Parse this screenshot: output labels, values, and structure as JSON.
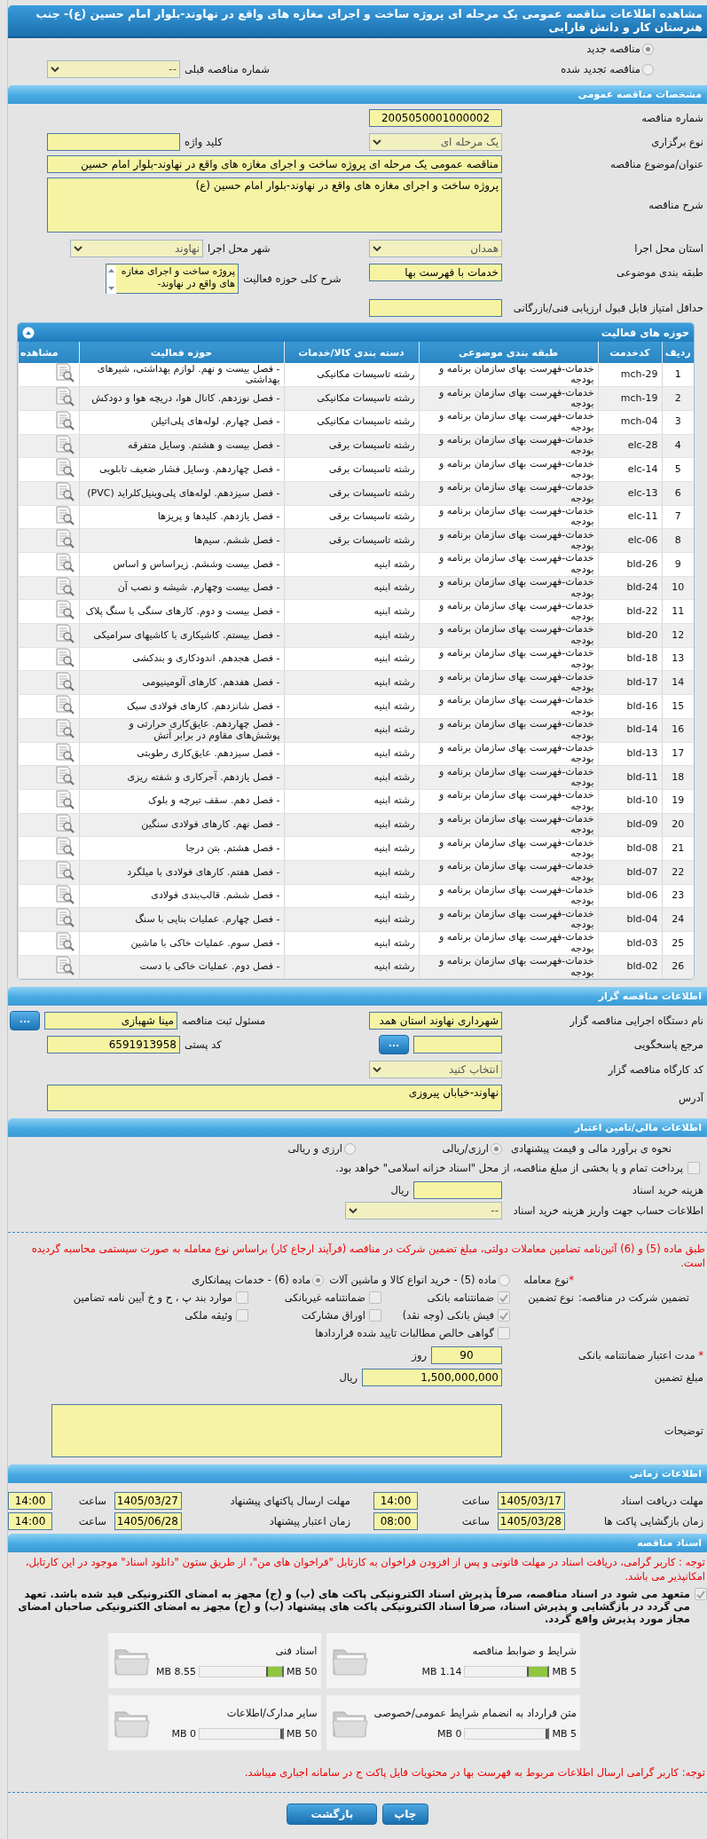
{
  "title": "مشاهده اطلاعات مناقصه عمومی یک مرحله ای پروژه ساخت و اجرای مغازه های واقع در نهاوند-بلوار امام حسین (ع)- جنب هنرستان کار و دانش فارابی",
  "tender_kind": [
    {
      "label": "مناقصه جدید",
      "selected": true
    },
    {
      "label": "مناقصه تجدید شده",
      "selected": false
    }
  ],
  "previous_number": {
    "label": "شماره مناقصه قبلی",
    "value": "--"
  },
  "general": {
    "header": "مشخصات مناقصه عمومی",
    "rows": [
      [
        {
          "label": "شماره مناقصه",
          "kind": "text",
          "value": "2005050001000002"
        }
      ],
      [
        {
          "label": "نوع برگزاری",
          "kind": "select",
          "value": "یک مرحله ای"
        },
        {
          "label": "کلید واژه",
          "kind": "text"
        }
      ],
      [
        {
          "label": "عنوان/موضوع مناقصه",
          "kind": "wide",
          "value": "مناقصه عمومی یک مرحله ای پروژه ساخت و اجرای مغازه های واقع در نهاوند-بلوار امام حسین"
        }
      ],
      [
        {
          "label": "شرح مناقصه",
          "kind": "textarea",
          "value": "پروژه ساخت و اجرای  مغازه های واقع در نهاوند-بلوار امام حسین (ع)"
        }
      ],
      [
        {
          "label": "استان محل اجرا",
          "kind": "select",
          "value": "همدان"
        },
        {
          "label": "شهر محل اجرا",
          "kind": "select",
          "value": "نهاوند"
        }
      ],
      [
        {
          "label": "طبقه بندی موضوعی",
          "kind": "text",
          "value": "خدمات با فهرست بها"
        },
        {
          "label": "شرح کلی حوزه فعالیت",
          "kind": "list",
          "value": "پروژه ساخت و اجرای مغازه های واقع در نهاوند-"
        }
      ],
      [
        {
          "label": "حداقل امتیاز قابل قبول ارزیابی فنی/بازرگانی",
          "kind": "text"
        }
      ]
    ]
  },
  "activities": {
    "title": "حوزه های فعالیت",
    "expanded": true,
    "columns": [
      "ردیف",
      "کدخدمت",
      "طبقه بندی موضوعی",
      "دسته بندی کالا/خدمات",
      "حوزه فعالیت",
      "مشاهده"
    ],
    "rows": [
      {
        "row": "1",
        "service_code": "mch-29",
        "subject_category": "خدمات-فهرست بهای سازمان برنامه و بودجه",
        "goods_category": "رشته تاسیسات مکانیکی",
        "activity": "- فصل بیست و نهم. لوازم بهداشتی، شیرهای بهداشتی"
      },
      {
        "row": "2",
        "service_code": "mch-19",
        "subject_category": "خدمات-فهرست بهای سازمان برنامه و بودجه",
        "goods_category": "رشته تاسیسات مکانیکی",
        "activity": "- فصل نوزدهم. کانال هوا، دریچه هوا و دودکش"
      },
      {
        "row": "3",
        "service_code": "mch-04",
        "subject_category": "خدمات-فهرست بهای سازمان برنامه و بودجه",
        "goods_category": "رشته تاسیسات مکانیکی",
        "activity": "- فصل چهارم. لوله‌های پلی‌اتیلن"
      },
      {
        "row": "4",
        "service_code": "elc-28",
        "subject_category": "خدمات-فهرست بهای سازمان برنامه و بودجه",
        "goods_category": "رشته تاسیسات برقی",
        "activity": "- فصل بیست و هشتم. وسایل متفرقه"
      },
      {
        "row": "5",
        "service_code": "elc-14",
        "subject_category": "خدمات-فهرست بهای سازمان برنامه و بودجه",
        "goods_category": "رشته تاسیسات برقی",
        "activity": "- فصل چهاردهم. وسایل فشار ضعیف تابلویی"
      },
      {
        "row": "6",
        "service_code": "elc-13",
        "subject_category": "خدمات-فهرست بهای سازمان برنامه و بودجه",
        "goods_category": "رشته تاسیسات برقی",
        "activity": "- فصل سیزدهم. لوله‌های پلی‌وینیل‌کلراید (PVC)"
      },
      {
        "row": "7",
        "service_code": "elc-11",
        "subject_category": "خدمات-فهرست بهای سازمان برنامه و بودجه",
        "goods_category": "رشته تاسیسات برقی",
        "activity": "- فصل یازدهم. کلیدها و پریزها"
      },
      {
        "row": "8",
        "service_code": "elc-06",
        "subject_category": "خدمات-فهرست بهای سازمان برنامه و بودجه",
        "goods_category": "رشته تاسیسات برقی",
        "activity": "- فصل ششم. سیم‌ها"
      },
      {
        "row": "9",
        "service_code": "bld-26",
        "subject_category": "خدمات-فهرست بهای سازمان برنامه و بودجه",
        "goods_category": "رشته ابنیه",
        "activity": "- فصل بیست وششم. زیراساس و اساس"
      },
      {
        "row": "10",
        "service_code": "bld-24",
        "subject_category": "خدمات-فهرست بهای سازمان برنامه و بودجه",
        "goods_category": "رشته ابنیه",
        "activity": "- فصل بیست وچهارم. شیشه و نصب آن"
      },
      {
        "row": "11",
        "service_code": "bld-22",
        "subject_category": "خدمات-فهرست بهای سازمان برنامه و بودجه",
        "goods_category": "رشته ابنیه",
        "activity": "- فصل بیست و دوم. کارهای سنگی با سنگ پلاک"
      },
      {
        "row": "12",
        "service_code": "bld-20",
        "subject_category": "خدمات-فهرست بهای سازمان برنامه و بودجه",
        "goods_category": "رشته ابنیه",
        "activity": "- فصل بیستم. کاشیکاری با کاشیهای سرامیکی"
      },
      {
        "row": "13",
        "service_code": "bld-18",
        "subject_category": "خدمات-فهرست بهای سازمان برنامه و بودجه",
        "goods_category": "رشته ابنیه",
        "activity": "- فصل هجدهم. اندودکاری و بندکشی"
      },
      {
        "row": "14",
        "service_code": "bld-17",
        "subject_category": "خدمات-فهرست بهای سازمان برنامه و بودجه",
        "goods_category": "رشته ابنیه",
        "activity": "- فصل هفدهم. کارهای آلومینیومی"
      },
      {
        "row": "15",
        "service_code": "bld-16",
        "subject_category": "خدمات-فهرست بهای سازمان برنامه و بودجه",
        "goods_category": "رشته ابنیه",
        "activity": "- فصل شانزدهم. کارهای فولادی سبک"
      },
      {
        "row": "16",
        "service_code": "bld-14",
        "subject_category": "خدمات-فهرست بهای سازمان برنامه و بودجه",
        "goods_category": "رشته ابنیه",
        "activity": "- فصل چهاردهم. عایق‌کاری حرارتی و پوشش‌های مقاوم در برابر آتش"
      },
      {
        "row": "17",
        "service_code": "bld-13",
        "subject_category": "خدمات-فهرست بهای سازمان برنامه و بودجه",
        "goods_category": "رشته ابنیه",
        "activity": "- فصل سیزدهم. عایق‌کاری رطوبتی"
      },
      {
        "row": "18",
        "service_code": "bld-11",
        "subject_category": "خدمات-فهرست بهای سازمان برنامه و بودجه",
        "goods_category": "رشته ابنیه",
        "activity": "- فصل یازدهم. آجرکاری و شفته ریزی"
      },
      {
        "row": "19",
        "service_code": "bld-10",
        "subject_category": "خدمات-فهرست بهای سازمان برنامه و بودجه",
        "goods_category": "رشته ابنیه",
        "activity": "- فصل دهم. سقف تیرچه و بلوک"
      },
      {
        "row": "20",
        "service_code": "bld-09",
        "subject_category": "خدمات-فهرست بهای سازمان برنامه و بودجه",
        "goods_category": "رشته ابنیه",
        "activity": "- فصل نهم. کارهای فولادی سنگین"
      },
      {
        "row": "21",
        "service_code": "bld-08",
        "subject_category": "خدمات-فهرست بهای سازمان برنامه و بودجه",
        "goods_category": "رشته ابنیه",
        "activity": "- فصل هشتم. بتن درجا"
      },
      {
        "row": "22",
        "service_code": "bld-07",
        "subject_category": "خدمات-فهرست بهای سازمان برنامه و بودجه",
        "goods_category": "رشته ابنیه",
        "activity": "- فصل هفتم. کارهای فولادی با میلگرد"
      },
      {
        "row": "23",
        "service_code": "bld-06",
        "subject_category": "خدمات-فهرست بهای سازمان برنامه و بودجه",
        "goods_category": "رشته ابنیه",
        "activity": "- فصل ششم. قالب‌بندی فولادی"
      },
      {
        "row": "24",
        "service_code": "bld-04",
        "subject_category": "خدمات-فهرست بهای سازمان برنامه و بودجه",
        "goods_category": "رشته ابنیه",
        "activity": "- فصل چهارم. عملیات بنایی با سنگ"
      },
      {
        "row": "25",
        "service_code": "bld-03",
        "subject_category": "خدمات-فهرست بهای سازمان برنامه و بودجه",
        "goods_category": "رشته ابنیه",
        "activity": "- فصل سوم. عملیات خاکی با ماشین"
      },
      {
        "row": "26",
        "service_code": "bld-02",
        "subject_category": "خدمات-فهرست بهای سازمان برنامه و بودجه",
        "goods_category": "رشته ابنیه",
        "activity": "- فصل دوم. عملیات خاکی با دست"
      }
    ]
  },
  "tenderer": {
    "header": "اطلاعات مناقصه گزار",
    "rows": [
      [
        {
          "label": "نام دستگاه اجرایی مناقصه گزار",
          "kind": "text",
          "value": "شهرداری نهاوند استان همد"
        },
        {
          "label": "مسئول ثبت مناقصه",
          "kind": "text",
          "value": "مینا شهبازی",
          "action": "..."
        }
      ],
      [
        {
          "label": "مرجع پاسخگویی",
          "kind": "text",
          "action": "..."
        },
        {
          "label": "کد پستی",
          "kind": "text",
          "value": "6591913958"
        }
      ],
      [
        {
          "label": "کد کارگاه مناقصه گزار",
          "kind": "select",
          "value": "انتخاب کنید"
        }
      ],
      [
        {
          "label": "آدرس",
          "kind": "address",
          "value": "نهاوند-خیابان پیروزی"
        }
      ]
    ]
  },
  "finance": {
    "header": "اطلاعات مالی/تامین اعتبار",
    "estimate": {
      "label": "نحوه ی برآورد مالی و قیمت پیشنهادی",
      "options": [
        {
          "label": "ارزی/ریالی",
          "selected": true
        },
        {
          "label": "ارزی و ریالی",
          "selected": false
        }
      ]
    },
    "treasury": {
      "label": "پرداخت تمام و یا بخشی از مبلغ مناقصه، از محل \"اسناد خزانه اسلامی\" خواهد بود.",
      "checked": false
    },
    "document_cost": {
      "label": "هزینه خرید اسناد",
      "unit": "ریال"
    },
    "account": {
      "label": "اطلاعات حساب جهت واریز هزینه خرید اسناد",
      "value": "--"
    },
    "note": "طبق ماده (5) و (6) آئین‌نامه تضامین معاملات دولتی، مبلغ تضمین شرکت در مناقصه (فرآیند ارجاع کار) براساس نوع معامله به صورت سیستمی محاسبه گردیده است.",
    "deal_type": {
      "required_mark": "*",
      "label": "نوع معامله",
      "options": [
        {
          "label": "ماده (5) - خرید انواع کالا و ماشین آلات",
          "selected": false
        },
        {
          "label": "ماده (6) - خدمات پیمانکاری",
          "selected": true
        }
      ]
    },
    "guarantee": {
      "label": "تضمین شرکت در مناقصه:",
      "type_label": "نوع تضمین",
      "options": [
        {
          "label": "ضمانتنامه بانکی",
          "checked": true
        },
        {
          "label": "ضمانتنامه غیربانکی",
          "checked": false
        },
        {
          "label": "موارد بند پ ، ح و خ آیین نامه تضامین",
          "checked": false
        },
        {
          "label": "فیش بانکی (وجه نقد)",
          "checked": true
        },
        {
          "label": "اوراق مشارکت",
          "checked": false
        },
        {
          "label": "وثیقه ملکی",
          "checked": false
        },
        {
          "label": "گواهی خالص مطالبات تایید شده قراردادها",
          "checked": false
        }
      ]
    },
    "validity": {
      "required_mark": "*",
      "label": "مدت اعتبار ضمانتنامه بانکی",
      "value": "90",
      "unit": "روز"
    },
    "amount": {
      "label": "مبلغ تضمین",
      "value": "1,500,000,000",
      "unit": "ریال"
    },
    "description": {
      "label": "توضیحات"
    }
  },
  "timing": {
    "header": "اطلاعات زمانی",
    "rows": [
      [
        {
          "label": "مهلت دریافت اسناد",
          "date": "1405/03/17",
          "time_label": "ساعت",
          "time": "14:00"
        },
        {
          "label": "مهلت ارسال پاکتهای پیشنهاد",
          "date": "1405/03/27",
          "time_label": "ساعت",
          "time": "14:00"
        }
      ],
      [
        {
          "label": "زمان بازگشایی پاکت ها",
          "date": "1405/03/28",
          "time_label": "ساعت",
          "time": "08:00"
        },
        {
          "label": "زمان اعتبار پیشنهاد",
          "date": "1405/06/28",
          "time_label": "ساعت",
          "time": "14:00"
        }
      ]
    ]
  },
  "documents": {
    "header": "اسناد مناقصه",
    "notice": "توجه : کاربر گرامی، دریافت اسناد در مهلت قانونی و پس از افزودن فراخوان به کارتابل \"فراخوان های من\"، از طریق ستون \"دانلود اسناد\" موجود در این کارتابل، امکانپذیر می باشد.",
    "commitment": {
      "label": "متعهد می شود در اسناد مناقصه، صرفاً پذیرش اسناد الکترونیکی پاکت های (ب) و (ج) مجهز به امضای الکترونیکی قید شده باشد. تعهد می گردد در بازگشایی و پذیرش اسناد، صرفاً اسناد الکترونیکی پاکت های پیشنهاد (ب) و (ج) مجهز به امضای الکترونیکی صاحبان امضای مجاز مورد پذیرش واقع گردد.",
      "checked": true
    },
    "files": [
      {
        "name": "شرایط و ضوابط مناقصه",
        "max": "5 MB",
        "size": "1.14 MB",
        "level": 0.228
      },
      {
        "name": "اسناد فنی",
        "max": "50 MB",
        "size": "8.55 MB",
        "level": 0.171
      },
      {
        "name": "متن قرارداد به انضمام شرایط عمومی/خصوصی",
        "max": "5 MB",
        "size": "0 MB",
        "level": 0
      },
      {
        "name": "سایر مدارک/اطلاعات",
        "max": "50 MB",
        "size": "0 MB",
        "level": 0
      }
    ],
    "footer_notice": "توجه: کاربر گرامی ارسال اطلاعات مربوط به فهرست بها در محتویات فایل پاکت ج در سامانه اجباری میباشد."
  },
  "buttons": [
    "چاپ",
    "بازگشت"
  ]
}
